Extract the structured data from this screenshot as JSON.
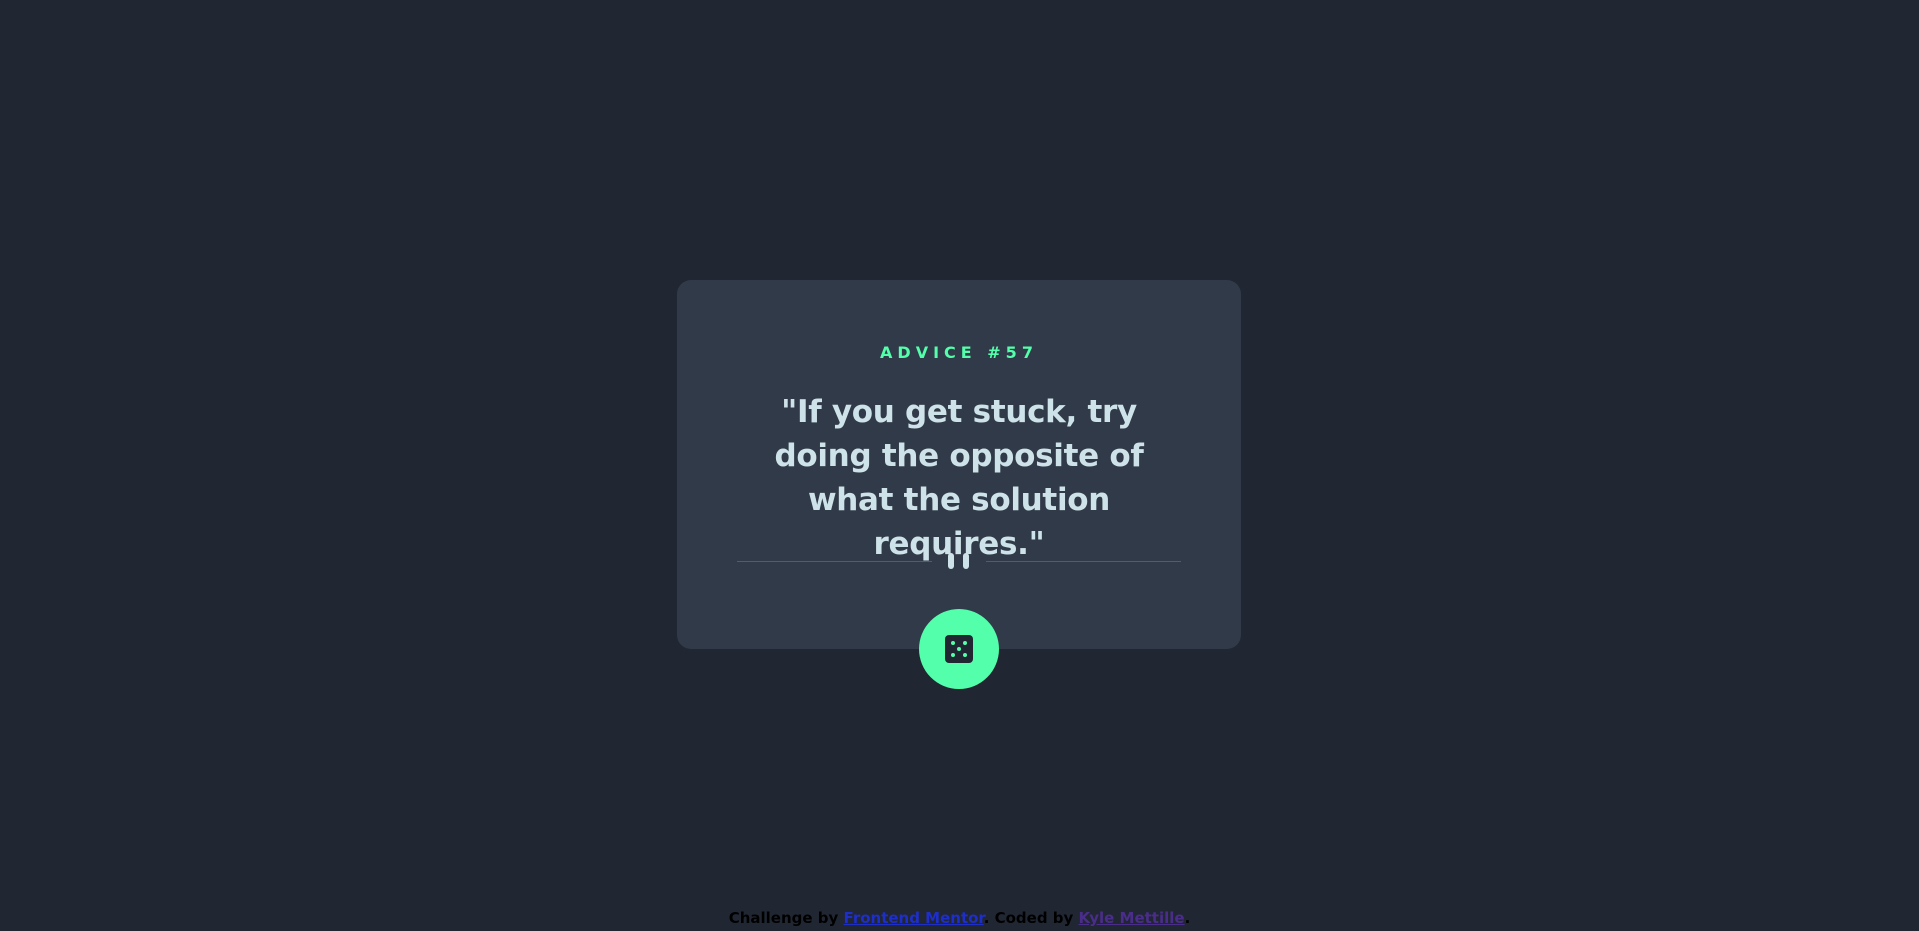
{
  "card": {
    "advice_label": "ADVICE #57",
    "quote": "\"If you get stuck, try doing the opposite of what the solution requires.\""
  },
  "button": {
    "icon": "dice-icon"
  },
  "footer": {
    "prefix": "Challenge by ",
    "challenge_link": "Frontend Mentor",
    "middle": ". Coded by ",
    "author_link": "Kyle Mettille",
    "suffix": "."
  },
  "colors": {
    "background": "#202632",
    "card": "#313a48",
    "accent": "#53ffaa",
    "text": "#cee3e9",
    "divider": "#4f5d74"
  }
}
